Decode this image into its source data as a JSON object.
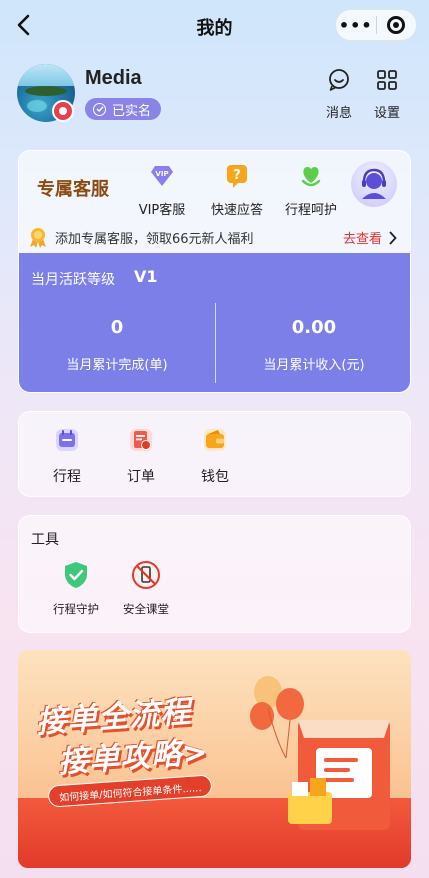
{
  "nav": {
    "title": "我的",
    "more": "•••"
  },
  "profile": {
    "name": "Media",
    "verified": "已实名"
  },
  "actions": {
    "messages": "消息",
    "settings": "设置"
  },
  "service": {
    "title": "专属客服",
    "items": [
      "VIP客服",
      "快速应答",
      "行程呵护"
    ],
    "promo": "添加专属客服，领取66元新人福利",
    "promo_link": "去查看"
  },
  "level": {
    "label": "当月活跃等级",
    "value": "V1",
    "completed_value": "0",
    "completed_label": "当月累计完成(单)",
    "income_value": "0.00",
    "income_label": "当月累计收入(元)"
  },
  "menu": {
    "items": [
      "行程",
      "订单",
      "钱包"
    ]
  },
  "tools": {
    "title": "工具",
    "items": [
      "行程守护",
      "安全课堂"
    ]
  },
  "banner": {
    "line1": "接单全流程",
    "line2": "接单攻略>",
    "sub": "如何接单/如何符合接单条件......"
  },
  "colors": {
    "accent": "#7d7fe8",
    "service_title": "#8a4b12",
    "link": "#e5312f"
  },
  "icons": [
    "back-icon",
    "more-icon",
    "target-icon",
    "location-badge-icon",
    "check-circle-icon",
    "message-icon",
    "grid-icon",
    "vip-icon",
    "question-icon",
    "heart-icon",
    "headset-avatar-icon",
    "medal-icon",
    "chevron-right-icon",
    "calendar-icon",
    "order-icon",
    "wallet-icon",
    "shield-check-icon",
    "no-phone-icon"
  ]
}
